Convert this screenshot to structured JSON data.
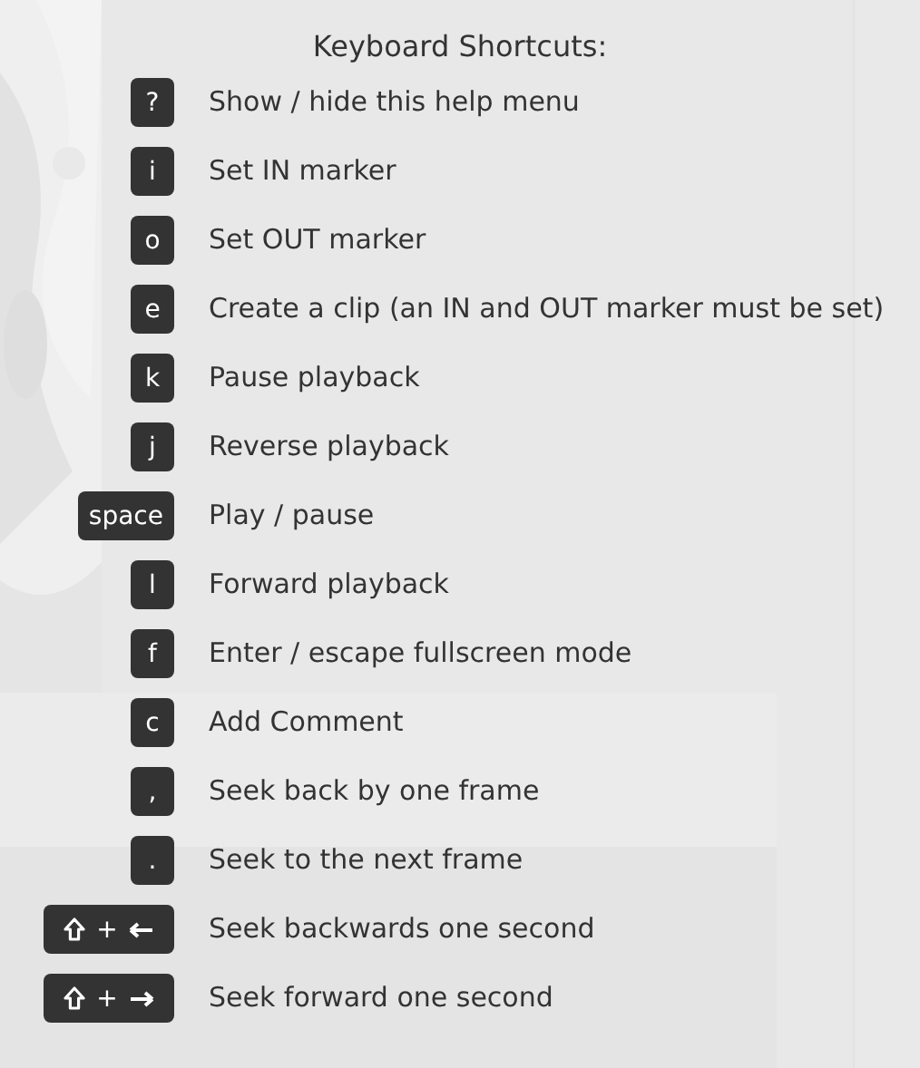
{
  "help": {
    "title": "Keyboard Shortcuts:",
    "shortcuts": [
      {
        "key": "?",
        "kind": "char",
        "description": "Show / hide this help menu"
      },
      {
        "key": "i",
        "kind": "char",
        "description": "Set IN marker"
      },
      {
        "key": "o",
        "kind": "char",
        "description": "Set OUT marker"
      },
      {
        "key": "e",
        "kind": "char",
        "description": "Create a clip (an IN and OUT marker must be set)"
      },
      {
        "key": "k",
        "kind": "char",
        "description": "Pause playback"
      },
      {
        "key": "j",
        "kind": "char",
        "description": "Reverse playback"
      },
      {
        "key": "space",
        "kind": "char",
        "description": "Play / pause"
      },
      {
        "key": "l",
        "kind": "char",
        "description": "Forward playback"
      },
      {
        "key": "f",
        "kind": "char",
        "description": "Enter / escape fullscreen mode"
      },
      {
        "key": "c",
        "kind": "char",
        "description": "Add Comment"
      },
      {
        "key": ",",
        "kind": "char",
        "description": "Seek back by one frame"
      },
      {
        "key": ".",
        "kind": "char",
        "description": "Seek to the next frame"
      },
      {
        "key": "+",
        "kind": "shift-left",
        "description": "Seek backwards one second"
      },
      {
        "key": "+",
        "kind": "shift-right",
        "description": "Seek forward one second"
      }
    ]
  }
}
